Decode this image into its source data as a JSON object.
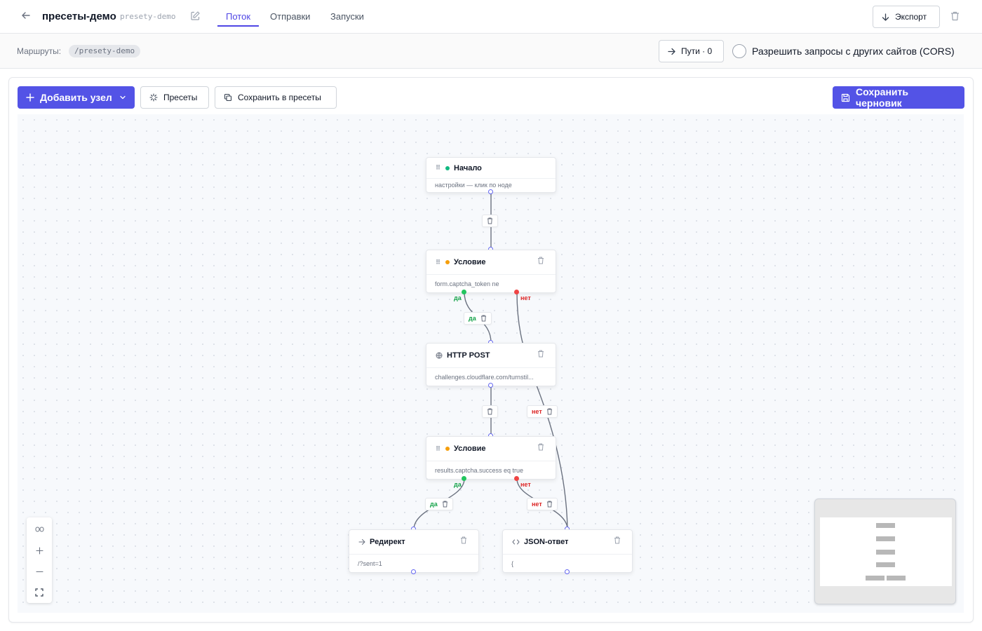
{
  "header": {
    "title": "пресеты-демо",
    "slug": "presety-demo",
    "tabs": [
      {
        "label": "Поток",
        "active": true
      },
      {
        "label": "Отправки",
        "active": false
      },
      {
        "label": "Запуски",
        "active": false
      }
    ],
    "export_label": "Экспорт"
  },
  "routes": {
    "label": "Маршруты:",
    "route": "/presety-demo",
    "paths_label": "Пути · 0",
    "cors_label": "Разрешить запросы с других сайтов (CORS)",
    "cors_enabled": false
  },
  "toolbar": {
    "add_node_label": "Добавить узел",
    "presets_label": "Пресеты",
    "save_to_presets_label": "Сохранить в пресеты",
    "save_draft_label": "Сохранить черновик"
  },
  "colors": {
    "accent": "#5353e6",
    "start_dot": "#10b981",
    "condition_dot": "#f59e0b",
    "yes": "#16a34a",
    "no": "#dc2626",
    "handle": "#6366f1"
  },
  "nodes": {
    "start": {
      "title": "Начало",
      "subtitle": "настройки — клик по ноде"
    },
    "condition1": {
      "title": "Условие",
      "subtitle": "form.captcha_token ne"
    },
    "http": {
      "title": "HTTP POST",
      "subtitle": "challenges.cloudflare.com/turnstil..."
    },
    "condition2": {
      "title": "Условие",
      "subtitle": "results.captcha.success eq true"
    },
    "redirect": {
      "title": "Редирект",
      "subtitle": "/?sent=1"
    },
    "json": {
      "title": "JSON-ответ",
      "subtitle": "{"
    }
  },
  "edge_labels": {
    "yes": "да",
    "no": "нет"
  }
}
